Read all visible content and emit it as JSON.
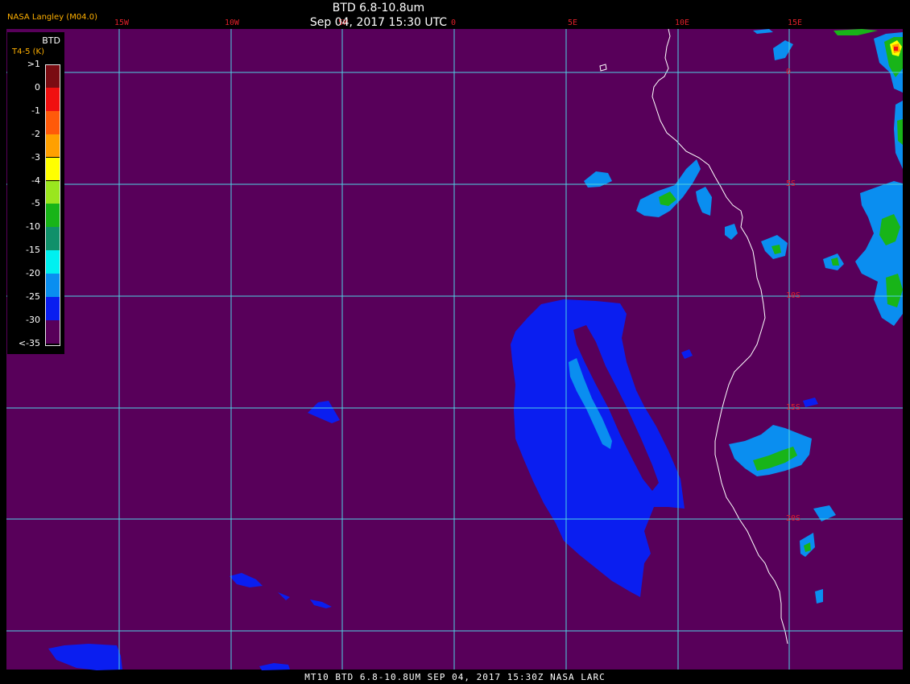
{
  "header": {
    "title": "BTD 6.8-10.8um",
    "datetime": "Sep 04, 2017 15:30 UTC",
    "product_tag": "NASA Langley (M04.0)"
  },
  "footer": {
    "caption": "MT10  BTD 6.8-10.8UM  SEP 04, 2017 15:30Z  NASA LARC"
  },
  "grid": {
    "longitude_labels": [
      "15W",
      "10W",
      "5W",
      "0",
      "5E",
      "10E",
      "15E"
    ],
    "latitude_labels": [
      "0",
      "5S",
      "10S",
      "15S",
      "20S"
    ],
    "line_color": "#4fd2e4",
    "label_color": "#e0202a"
  },
  "legend": {
    "title": "BTD",
    "subtitle": "T4-5 (K)",
    "entries": [
      {
        "label": ">1",
        "color": "#7a0c12"
      },
      {
        "label": "0",
        "color": "#f01010"
      },
      {
        "label": "-1",
        "color": "#ff5a0a"
      },
      {
        "label": "-2",
        "color": "#ffa000"
      },
      {
        "label": "-3",
        "color": "#ffff00"
      },
      {
        "label": "-4",
        "color": "#9ae61e"
      },
      {
        "label": "-5",
        "color": "#18b418"
      },
      {
        "label": "-10",
        "color": "#10906a"
      },
      {
        "label": "-15",
        "color": "#00f0f0"
      },
      {
        "label": "-20",
        "color": "#0a8ef0"
      },
      {
        "label": "-25",
        "color": "#0a1ef0"
      },
      {
        "label": "-30",
        "color": "#58005a"
      },
      {
        "label": "<-35",
        "color": ""
      }
    ]
  },
  "colors": {
    "background_field": "#58005a",
    "cloud_low": "#0a1ef0",
    "cloud_mid": "#0a8ef0",
    "cloud_cyan": "#00f0f0",
    "cloud_green": "#18b418",
    "cloud_yellowgreen": "#9ae61e",
    "cloud_orange": "#ffa000",
    "cloud_red": "#f01010",
    "coastline": "#ffffff"
  }
}
